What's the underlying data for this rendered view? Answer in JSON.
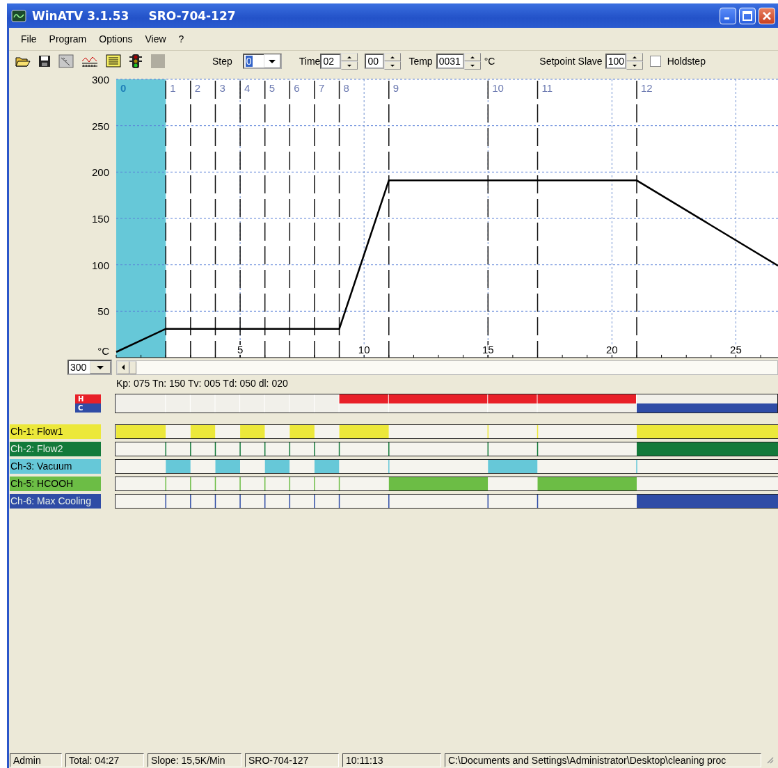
{
  "window": {
    "title": "WinATV 3.1.53",
    "subtitle": "SRO-704-127"
  },
  "menu": [
    "File",
    "Program",
    "Options",
    "View",
    "?"
  ],
  "toolbar": {
    "icons": [
      {
        "kind": "open"
      },
      {
        "kind": "save"
      },
      {
        "kind": "calibrate"
      },
      {
        "kind": "chart"
      },
      {
        "kind": "list"
      },
      {
        "kind": "traffic-light"
      },
      {
        "kind": "blank"
      }
    ],
    "step": {
      "label": "Step",
      "value": "0"
    },
    "time": {
      "label": "Time",
      "hours": "02",
      "minutes": "00"
    },
    "temp": {
      "label": "Temp",
      "value": "0031",
      "unit": "°C"
    },
    "setpoint": {
      "label": "Setpoint Slave",
      "value": "100"
    },
    "holdstep": {
      "label": "Holdstep",
      "checked": false
    }
  },
  "chart": {
    "chart_data": {
      "type": "line",
      "grid": true,
      "x": [
        0,
        2,
        9,
        11,
        21,
        26.7
      ],
      "xlim": [
        0,
        26.7
      ],
      "ylim": [
        0,
        300
      ],
      "xticks": [
        5,
        10,
        15,
        20,
        25
      ],
      "yticks": [
        {
          "value": 0,
          "label": "°C"
        },
        50,
        100,
        150,
        200,
        250,
        300
      ],
      "series": [
        {
          "color": "#000000",
          "values": [
            6,
            31,
            31,
            191,
            191,
            99
          ]
        }
      ],
      "bands": [
        {
          "axis": "x",
          "from": 0,
          "to": 2,
          "color": "#66c8d8"
        }
      ],
      "ref_lines": [
        {
          "axis": "x",
          "value": 2
        },
        {
          "axis": "x",
          "value": 3
        },
        {
          "axis": "x",
          "value": 4
        },
        {
          "axis": "x",
          "value": 5
        },
        {
          "axis": "x",
          "value": 6
        },
        {
          "axis": "x",
          "value": 7
        },
        {
          "axis": "x",
          "value": 8
        },
        {
          "axis": "x",
          "value": 9
        },
        {
          "axis": "x",
          "value": 11
        },
        {
          "axis": "x",
          "value": 15
        },
        {
          "axis": "x",
          "value": 17
        },
        {
          "axis": "x",
          "value": 21
        }
      ]
    },
    "steps": [
      {
        "label": "0",
        "selected": true
      },
      {
        "label": "1",
        "selected": false
      },
      {
        "label": "2",
        "selected": false
      },
      {
        "label": "3",
        "selected": false
      },
      {
        "label": "4",
        "selected": false
      },
      {
        "label": "5",
        "selected": false
      },
      {
        "label": "6",
        "selected": false
      },
      {
        "label": "7",
        "selected": false
      },
      {
        "label": "8",
        "selected": false
      },
      {
        "label": "9",
        "selected": false
      },
      {
        "label": "10",
        "selected": false
      },
      {
        "label": "11",
        "selected": false
      },
      {
        "label": "12",
        "selected": false
      }
    ]
  },
  "scale": {
    "value": "300"
  },
  "pid_text": "Kp: 075 Tn: 150 Tv: 005 Td: 050 dl: 020",
  "heat_cool": [
    {
      "label": "H",
      "color": "#e82028",
      "on": [
        false,
        false,
        false,
        false,
        false,
        false,
        false,
        false,
        true,
        true,
        true,
        true,
        false
      ]
    },
    {
      "label": "C",
      "color": "#2f4ca6",
      "on": [
        false,
        false,
        false,
        false,
        false,
        false,
        false,
        false,
        false,
        false,
        false,
        false,
        true
      ]
    }
  ],
  "channels": [
    {
      "label": "Ch-1: Flow1",
      "color": "#ece83a",
      "on": [
        true,
        false,
        true,
        false,
        true,
        false,
        true,
        false,
        true,
        false,
        false,
        false,
        true
      ]
    },
    {
      "label": "Ch-2: Flow2",
      "color": "#137a3a",
      "on": [
        false,
        false,
        false,
        false,
        false,
        false,
        false,
        false,
        false,
        false,
        false,
        false,
        true
      ]
    },
    {
      "label": "Ch-3: Vacuum",
      "color": "#66c8d8",
      "on": [
        false,
        true,
        false,
        true,
        false,
        true,
        false,
        true,
        false,
        false,
        true,
        false,
        false
      ]
    },
    {
      "label": "Ch-5: HCOOH",
      "color": "#6cbd45",
      "on": [
        false,
        false,
        false,
        false,
        false,
        false,
        false,
        false,
        false,
        true,
        false,
        true,
        false
      ]
    },
    {
      "label": "Ch-6: Max Cooling",
      "color": "#2f4ca6",
      "on": [
        false,
        false,
        false,
        false,
        false,
        false,
        false,
        false,
        false,
        false,
        false,
        false,
        true
      ]
    }
  ],
  "status_bar": [
    "Admin",
    "Total: 04:27",
    "Slope: 15,5K/Min",
    "SRO-704-127",
    "10:11:13",
    "C:\\Documents and Settings\\Administrator\\Desktop\\cleaning proc"
  ]
}
